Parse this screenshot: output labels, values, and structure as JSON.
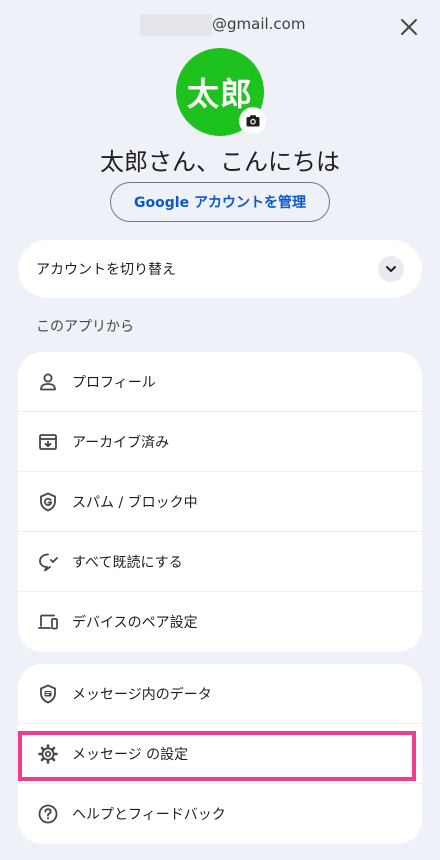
{
  "header": {
    "email_suffix": "@gmail.com",
    "close_icon": "close-icon"
  },
  "profile": {
    "avatar_text": "太郎",
    "avatar_color": "#1ec21e",
    "camera_icon": "camera-icon",
    "greeting": "太郎さん、こんにちは",
    "manage_button": "Google アカウントを管理"
  },
  "account_switch": {
    "label": "アカウントを切り替え",
    "chevron_icon": "chevron-down-icon"
  },
  "section": {
    "label": "このアプリから"
  },
  "menu_group_1": [
    {
      "label": "プロフィール",
      "icon": "person-icon"
    },
    {
      "label": "アーカイブ済み",
      "icon": "archive-icon"
    },
    {
      "label": "スパム / ブロック中",
      "icon": "shield-g-icon"
    },
    {
      "label": "すべて既読にする",
      "icon": "mark-read-icon"
    },
    {
      "label": "デバイスのペア設定",
      "icon": "devices-icon"
    }
  ],
  "menu_group_2": [
    {
      "label": "メッセージ内のデータ",
      "icon": "data-shield-icon"
    },
    {
      "label": "メッセージ の設定",
      "icon": "gear-icon"
    },
    {
      "label": "ヘルプとフィードバック",
      "icon": "help-icon"
    }
  ],
  "colors": {
    "background": "#eef1f7",
    "accent_text": "#0b57d0",
    "highlight": "#f03c8c"
  }
}
